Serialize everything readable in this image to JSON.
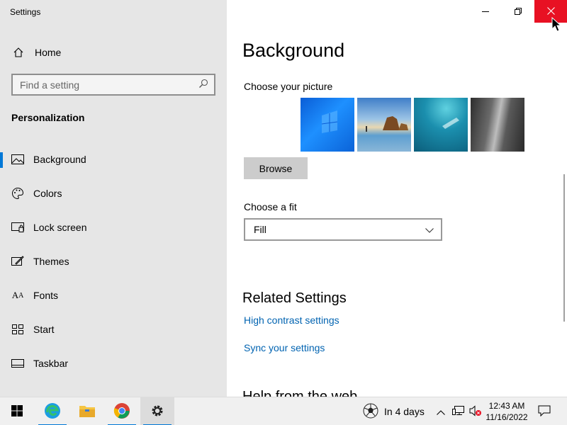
{
  "window": {
    "app_title": "Settings",
    "minimize_icon": "minimize-icon",
    "restore_icon": "restore-icon",
    "close_icon": "close-icon"
  },
  "sidebar": {
    "home_label": "Home",
    "search_placeholder": "Find a setting",
    "section_title": "Personalization",
    "items": [
      {
        "label": "Background",
        "icon": "picture-icon",
        "active": true
      },
      {
        "label": "Colors",
        "icon": "palette-icon",
        "active": false
      },
      {
        "label": "Lock screen",
        "icon": "lock-screen-icon",
        "active": false
      },
      {
        "label": "Themes",
        "icon": "themes-icon",
        "active": false
      },
      {
        "label": "Fonts",
        "icon": "fonts-icon",
        "active": false
      },
      {
        "label": "Start",
        "icon": "start-icon",
        "active": false
      },
      {
        "label": "Taskbar",
        "icon": "taskbar-icon",
        "active": false
      }
    ]
  },
  "main": {
    "title": "Background",
    "choose_picture_label": "Choose your picture",
    "browse_label": "Browse",
    "choose_fit_label": "Choose a fit",
    "fit_value": "Fill",
    "related_title": "Related Settings",
    "link_high_contrast": "High contrast settings",
    "link_sync": "Sync your settings",
    "help_title": "Help from the web"
  },
  "taskbar": {
    "weather_text": "In 4 days",
    "time": "12:43 AM",
    "date": "11/16/2022"
  },
  "colors": {
    "accent": "#0078d7",
    "close_red": "#e81123",
    "link": "#0063b1",
    "sidebar_bg": "#e6e6e6"
  }
}
